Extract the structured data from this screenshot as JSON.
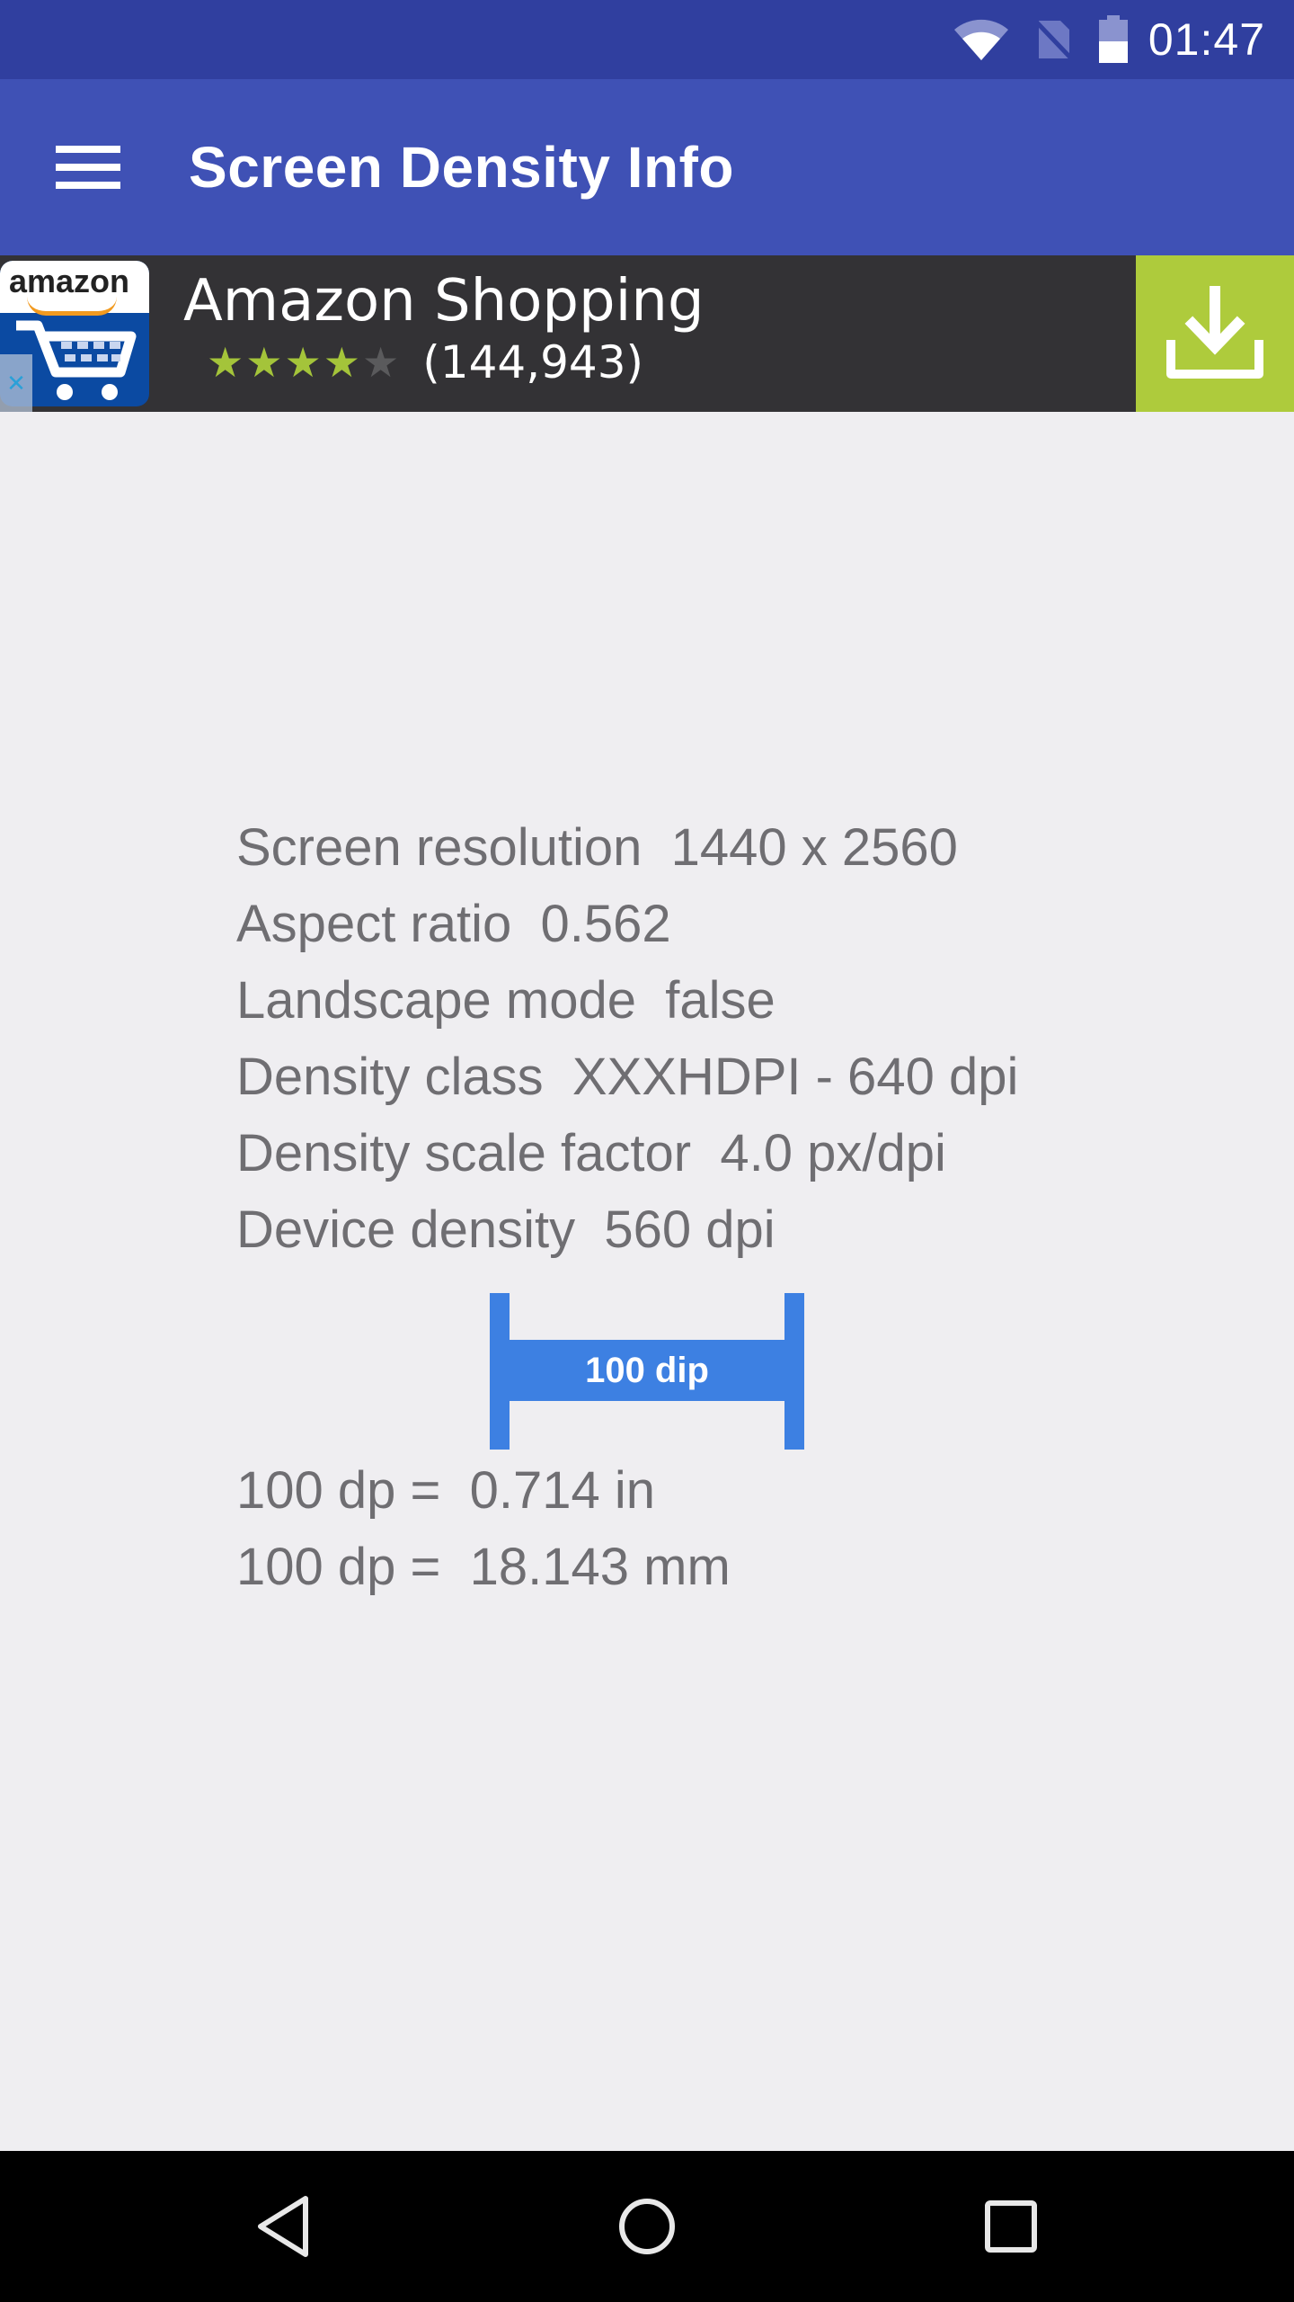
{
  "status_bar": {
    "time": "01:47",
    "icons": [
      "wifi-icon",
      "no-sim-icon",
      "battery-icon"
    ],
    "battery_level": 0.5
  },
  "app_bar": {
    "menu_icon": "menu-icon",
    "title": "Screen Density Info",
    "color": "#3f51b5"
  },
  "ad": {
    "logo_text": "amazon",
    "title": "Amazon Shopping",
    "rating": 4,
    "rating_max": 5,
    "rating_count": "(144,943)",
    "star_color": "#a4c43a",
    "install_icon": "download-icon",
    "install_color": "#aecb3c",
    "ad_choices_icon": "adchoices-icon"
  },
  "info": {
    "rows": [
      {
        "label": "Screen resolution",
        "value": "1440 x 2560"
      },
      {
        "label": "Aspect ratio",
        "value": "0.562"
      },
      {
        "label": "Landscape mode",
        "value": "false"
      },
      {
        "label": "Density class",
        "value": "XXXHDPI - 640 dpi"
      },
      {
        "label": "Density scale factor",
        "value": "4.0 px/dpi"
      },
      {
        "label": "Device density",
        "value": "560 dpi"
      }
    ]
  },
  "ruler": {
    "label": "100 dip",
    "color": "#3d80e2"
  },
  "conversions": [
    {
      "label": "100 dp =",
      "value": "0.714 in"
    },
    {
      "label": "100 dp =",
      "value": "18.143 mm"
    }
  ],
  "nav_bar": {
    "buttons": [
      "back-icon",
      "home-icon",
      "recents-icon"
    ]
  }
}
